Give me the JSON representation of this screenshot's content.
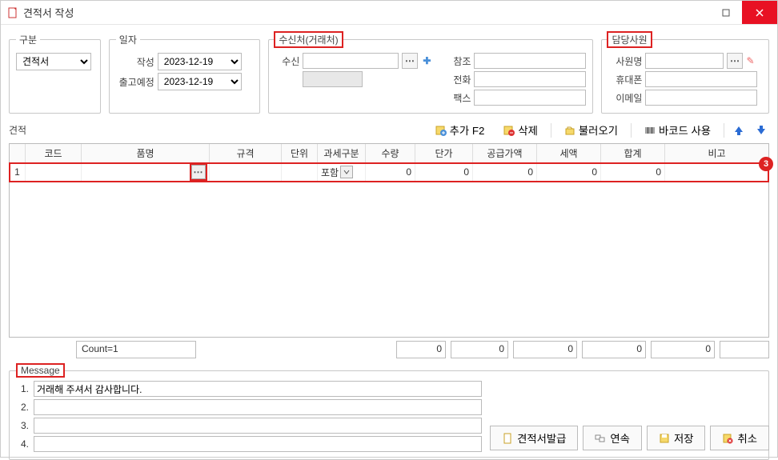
{
  "window": {
    "title": "견적서 작성"
  },
  "gubun": {
    "legend": "구분",
    "value": "견적서"
  },
  "date": {
    "legend": "일자",
    "created_label": "작성",
    "created_value": "2023-12-19",
    "ship_label": "출고예정",
    "ship_value": "2023-12-19"
  },
  "recipient": {
    "legend": "수신처(거래처)",
    "to_label": "수신",
    "to_value": "",
    "ref_label": "참조",
    "ref_value": "",
    "tel_label": "전화",
    "tel_value": "",
    "fax_label": "팩스",
    "fax_value": ""
  },
  "employee": {
    "legend": "담당사원",
    "name_label": "사원명",
    "name_value": "",
    "mobile_label": "휴대폰",
    "mobile_value": "",
    "email_label": "이메일",
    "email_value": ""
  },
  "toolbar": {
    "list_label": "견적",
    "add_label": "추가 F2",
    "del_label": "삭제",
    "load_label": "불러오기",
    "barcode_label": "바코드 사용"
  },
  "grid": {
    "headers": {
      "code": "코드",
      "name": "품명",
      "spec": "규격",
      "unit": "단위",
      "tax": "과세구분",
      "qty": "수량",
      "price": "단가",
      "supply": "공급가액",
      "taxamt": "세액",
      "total": "합계",
      "note": "비고"
    },
    "row1": {
      "num": "1",
      "tax_value": "포함",
      "qty": "0",
      "price": "0",
      "supply": "0",
      "taxamt": "0",
      "total": "0"
    },
    "badge": "3"
  },
  "totals": {
    "count": "Count=1",
    "qty": "0",
    "price": "0",
    "supply": "0",
    "taxamt": "0",
    "total": "0",
    "note": ""
  },
  "message": {
    "legend": "Message",
    "m1": "거래해 주셔서 감사합니다.",
    "m2": "",
    "m3": "",
    "m4": "",
    "n1": "1.",
    "n2": "2.",
    "n3": "3.",
    "n4": "4."
  },
  "footer": {
    "issue": "견적서발급",
    "cont": "연속",
    "save": "저장",
    "cancel": "취소"
  }
}
